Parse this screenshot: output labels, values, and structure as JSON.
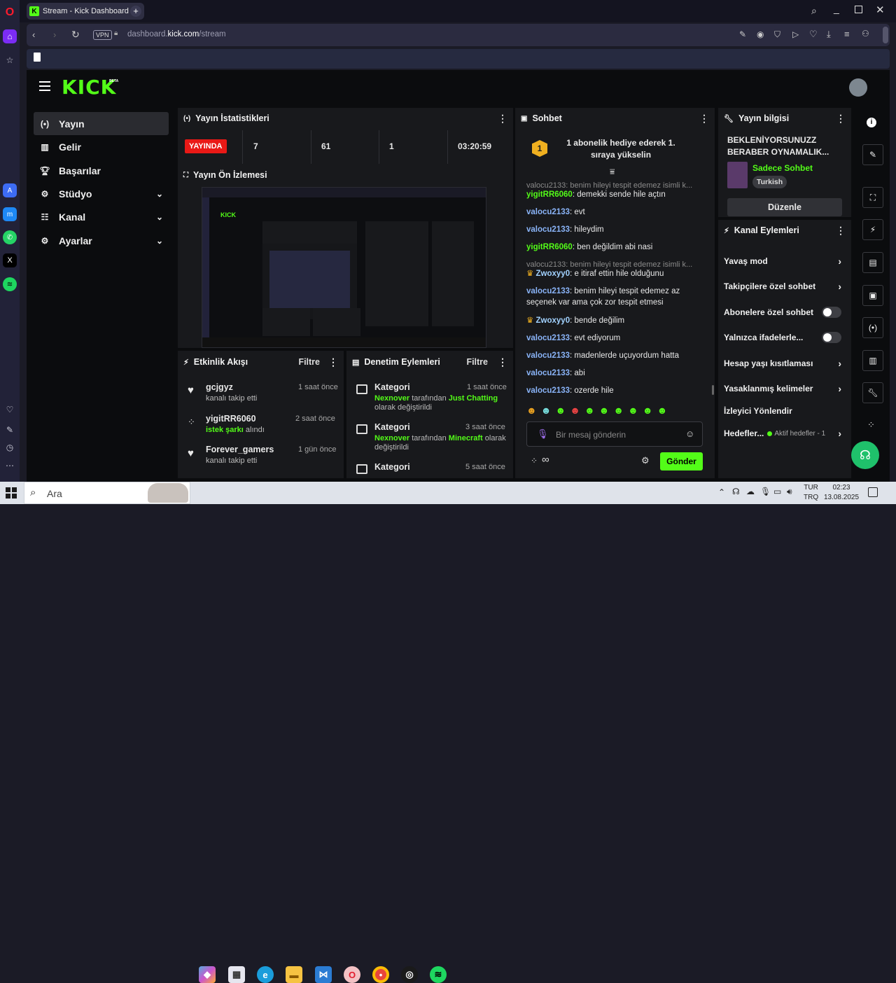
{
  "browser": {
    "tab_title": "Stream - Kick Dashboard",
    "tab_favicon": "K",
    "new_tab": "+",
    "url_prefix": "dashboard.",
    "url_domain": "kick.com",
    "url_path": "/stream",
    "vpn": "VPN"
  },
  "kick": {
    "logo": "KICK",
    "logo_badge": "BETA",
    "nav": [
      {
        "label": "Yayın",
        "icon": "broadcast-icon"
      },
      {
        "label": "Gelir",
        "icon": "revenue-icon"
      },
      {
        "label": "Başarılar",
        "icon": "trophy-icon"
      },
      {
        "label": "Stüdyo",
        "icon": "studio-icon"
      },
      {
        "label": "Kanal",
        "icon": "channel-icon"
      },
      {
        "label": "Ayarlar",
        "icon": "settings-icon"
      }
    ],
    "stats": {
      "title": "Yayın İstatistikleri",
      "live_badge": "YAYINDA",
      "values": [
        "7",
        "61",
        "1",
        "03:20:59"
      ]
    },
    "preview": {
      "title": "Yayın Ön İzlemesi"
    },
    "activity": {
      "title": "Etkinlik Akışı",
      "filter": "Filtre",
      "items": [
        {
          "user": "gcjgyz",
          "time": "1 saat önce",
          "action": "kanalı takip etti",
          "highlight": ""
        },
        {
          "user": "yigitRR6060",
          "time": "2 saat önce",
          "action": " alındı",
          "highlight": "istek şarkı"
        },
        {
          "user": "Forever_gamers",
          "time": "1 gün önce",
          "action": "kanalı takip etti",
          "highlight": ""
        }
      ]
    },
    "moderation": {
      "title": "Denetim Eylemleri",
      "filter": "Filtre",
      "items": [
        {
          "title": "Kategori",
          "time": "1 saat önce",
          "by": "Nexnover",
          "mid": " tarafından ",
          "cat": "Just Chatting",
          "tail": "olarak değiştirildi"
        },
        {
          "title": "Kategori",
          "time": "3 saat önce",
          "by": "Nexnover",
          "mid": " tarafından ",
          "cat": "Minecraft",
          "tail": "olarak değiştirildi"
        },
        {
          "title": "Kategori",
          "time": "5 saat önce"
        }
      ]
    },
    "chat": {
      "title": "Sohbet",
      "pinned_rank": "1",
      "pinned_text": "1 abonelik hediye ederek 1. sıraya yükselin",
      "messages": [
        {
          "reply": "valocu2133: benim hileyi tespit edemez isimli k...",
          "user": "yigitRR6060",
          "cls": "u-green",
          "text": "demekki sende hile açtın"
        },
        {
          "reply": "",
          "user": "valocu2133",
          "cls": "u-blue",
          "text": "evt"
        },
        {
          "reply": "",
          "user": "valocu2133",
          "cls": "u-blue",
          "text": "hileydim"
        },
        {
          "reply": "",
          "user": "yigitRR6060",
          "cls": "u-green",
          "text": "ben değildim abi nasi"
        },
        {
          "reply": "valocu2133: benim hileyi tespit edemez isimli k...",
          "user": "Zwoxyy0",
          "cls": "u-pink",
          "text": "e itiraf ettin hile olduğunu"
        },
        {
          "reply": "",
          "user": "valocu2133",
          "cls": "u-blue",
          "text": "benim hileyi tespit edemez az seçenek var ama çok zor tespit etmesi"
        },
        {
          "reply": "",
          "user": "Zwoxyy0",
          "cls": "u-pink",
          "text": "bende değilim"
        },
        {
          "reply": "",
          "user": "valocu2133",
          "cls": "u-blue",
          "text": "evt ediyorum"
        },
        {
          "reply": "",
          "user": "valocu2133",
          "cls": "u-blue",
          "text": "madenlerde uçuyordum hatta"
        },
        {
          "reply": "",
          "user": "valocu2133",
          "cls": "u-blue",
          "text": "abi"
        },
        {
          "reply": "",
          "user": "valocu2133",
          "cls": "u-blue",
          "text": "ozerde hile"
        }
      ],
      "input_placeholder": "Bir mesaj gönderin",
      "send": "Gönder",
      "infinity": "∞"
    },
    "stream_info": {
      "title": "Yayın bilgisi",
      "stream_title": "BEKLENİYORSUNUZZ BERABER OYNAMALIK...",
      "category": "Sadece Sohbet",
      "tag": "Turkish",
      "edit": "Düzenle"
    },
    "channel_actions": {
      "title": "Kanal Eylemleri",
      "items": [
        {
          "label": "Yavaş mod",
          "control": "chevron"
        },
        {
          "label": "Takipçilere özel sohbet",
          "control": "chevron"
        },
        {
          "label": "Abonelere özel sohbet",
          "control": "toggle"
        },
        {
          "label": "Yalnızca ifadelerle...",
          "control": "toggle"
        },
        {
          "label": "Hesap yaşı kısıtlaması",
          "control": "chevron"
        },
        {
          "label": "Yasaklanmış kelimeler",
          "control": "chevron"
        },
        {
          "label": "İzleyici Yönlendir",
          "control": "none"
        }
      ],
      "goals_label": "Hedefler...",
      "goals_status": "Aktif hedefler - 1"
    }
  },
  "taskbar": {
    "search": "Ara",
    "lang": "TUR",
    "lang2": "TRQ",
    "time": "02:23",
    "date": "13.08.2025"
  }
}
